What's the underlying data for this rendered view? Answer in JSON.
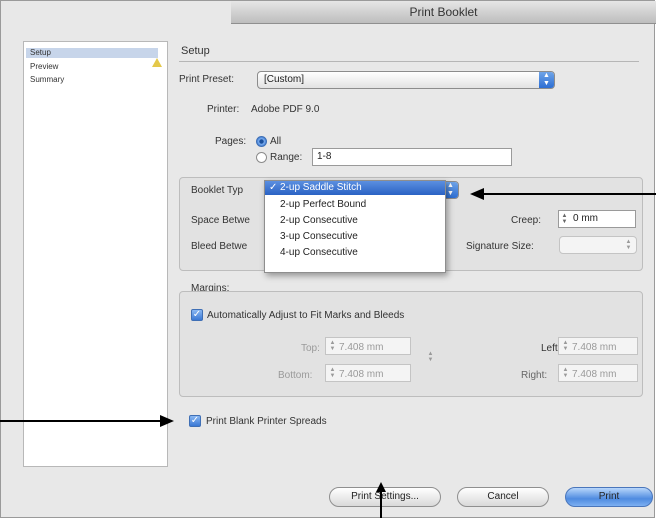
{
  "window": {
    "title": "Print Booklet"
  },
  "sidebar": {
    "items": [
      {
        "label": "Setup",
        "selected": true
      },
      {
        "label": "Preview",
        "warning": true
      },
      {
        "label": "Summary"
      }
    ]
  },
  "setup": {
    "section_title": "Setup",
    "print_preset_label": "Print Preset:",
    "print_preset_value": "[Custom]",
    "printer_label": "Printer:",
    "printer_value": "Adobe PDF 9.0",
    "pages_label": "Pages:",
    "pages_all_label": "All",
    "pages_range_label": "Range:",
    "pages_range_value": "1-8",
    "pages_selected": "All",
    "booklet_type_label": "Booklet Typ",
    "space_between_label": "Space Betwe",
    "bleed_between_label": "Bleed Betwe",
    "creep_label": "Creep:",
    "creep_value": "0 mm",
    "signature_size_label": "Signature Size:"
  },
  "booklet_menu": {
    "options": [
      {
        "label": "2-up Saddle Stitch",
        "selected": true
      },
      {
        "label": "2-up Perfect Bound"
      },
      {
        "label": "2-up Consecutive"
      },
      {
        "label": "3-up Consecutive"
      },
      {
        "label": "4-up Consecutive"
      }
    ],
    "checkmark": "✓"
  },
  "margins": {
    "title": "Margins:",
    "auto_adjust_label": "Automatically Adjust to Fit Marks and Bleeds",
    "auto_adjust_checked": true,
    "top_label": "Top:",
    "top_value": "7.408 mm",
    "bottom_label": "Bottom:",
    "bottom_value": "7.408 mm",
    "left_label": "Left:",
    "left_value": "7.408 mm",
    "right_label": "Right:",
    "right_value": "7.408 mm"
  },
  "print_blank": {
    "label": "Print Blank Printer Spreads",
    "checked": true
  },
  "buttons": {
    "print_settings": "Print Settings...",
    "cancel": "Cancel",
    "print": "Print"
  },
  "colors": {
    "accent": "#2a62c4",
    "selection": "#c7d5ea",
    "warning": "#e4c84a"
  }
}
